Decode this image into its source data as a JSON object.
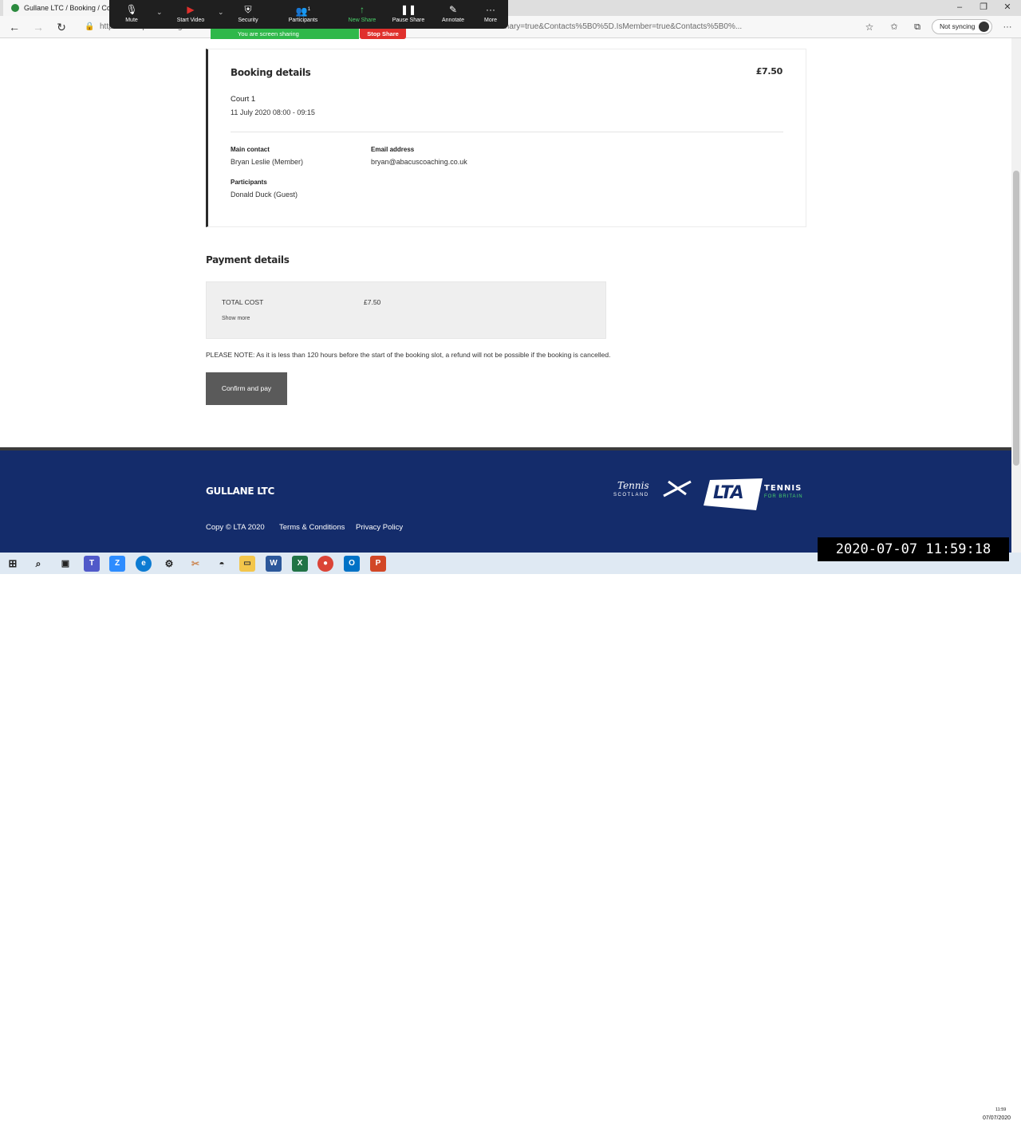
{
  "browser": {
    "tab_title": "Gullane LTC / Booking / Confirm",
    "url": "https://clubspark.lta.org.uk/GullaneLTC/Booking/Confirm?...ContactName=Bryan+Leslie&Contacts%5B0%5D.IsPrimary=true&Contacts%5B0%5D.IsMember=true&Contacts%5B0%...",
    "sync_label": "Not syncing",
    "window_minimize": "–",
    "window_restore": "❐",
    "window_close": "✕",
    "nav_back": "←",
    "nav_forward": "→",
    "nav_refresh": "↻",
    "favorite_icon": "☆",
    "collections_icon": "⧉",
    "more_icon": "···"
  },
  "zoom": {
    "buttons": [
      {
        "icon": "🎙",
        "label": "Mute"
      },
      {
        "icon": "▶",
        "label": "Start Video"
      },
      {
        "icon": "⛨",
        "label": "Security"
      },
      {
        "icon": "👥",
        "label": "Participants",
        "count": "1"
      },
      {
        "icon": "↑",
        "label": "New Share"
      },
      {
        "icon": "❚❚",
        "label": "Pause Share"
      },
      {
        "icon": "✎",
        "label": "Annotate"
      },
      {
        "icon": "···",
        "label": "More"
      }
    ],
    "sharing_text": "You are screen sharing",
    "stop_share": "Stop Share",
    "green": "#49d26a",
    "red": "#e0302c"
  },
  "booking": {
    "title": "Booking details",
    "price": "£7.50",
    "court": "Court 1",
    "datetime": "11 July 2020 08:00 - 09:15",
    "main_contact_label": "Main contact",
    "main_contact_value": "Bryan Leslie (Member)",
    "email_label": "Email address",
    "email_value": "bryan@abacuscoaching.co.uk",
    "participants_label": "Participants",
    "participants_value": "Donald Duck (Guest)"
  },
  "payment": {
    "title": "Payment details",
    "total_label": "TOTAL COST",
    "total_value": "£7.50",
    "show_more": "Show more",
    "note": "PLEASE NOTE: As it is less than 120 hours before the start of the booking slot, a refund will not be possible if the booking is cancelled.",
    "confirm_label": "Confirm and pay"
  },
  "footer": {
    "club_name": "GULLANE LTC",
    "copyright": "Copy © LTA 2020",
    "terms": "Terms & Conditions",
    "privacy": "Privacy Policy",
    "tennis_scotland_line1": "Tennis",
    "tennis_scotland_line2": "SCOTLAND",
    "lta_text": "LTA",
    "lta_tennis": "TENNIS",
    "lta_sub": "FOR BRITAIN",
    "background": "#142c6b"
  },
  "taskbar": {
    "timestamp": "2020-07-07  11:59:18",
    "tray_date": "07/07/2020",
    "tray_time": "11:59"
  }
}
